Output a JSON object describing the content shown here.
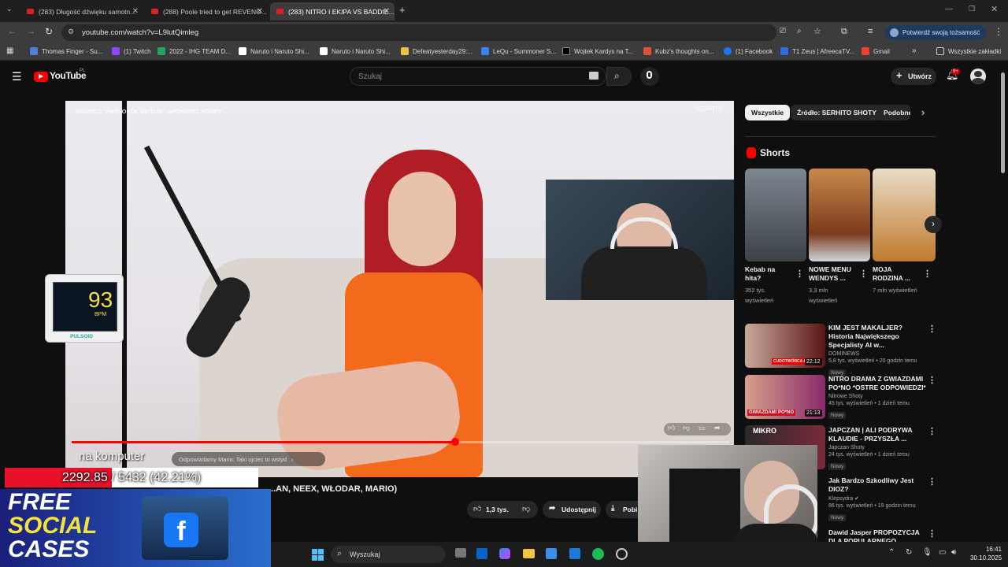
{
  "tabs": [
    {
      "label": "(283) Długość dźwięku samotn..."
    },
    {
      "label": "(288) Poole tried to get REVENG..."
    },
    {
      "label": "(283) NITRO I EKIPA VS BADDIE..."
    }
  ],
  "url": "youtube.com/watch?v=L9lutQimleg",
  "profile_chip": "Potwierdź swoją tożsamość",
  "bookmarks": [
    "Thomas Finger - Su...",
    "(1) Twitch",
    "2022 - IHG TEAM D...",
    "Naruto i Naruto Shi...",
    "Naruto i Naruto Shi...",
    "Defeatyesterday29:...",
    "LeQu - Summoner S...",
    "Wojtek Kardys na T...",
    "Kubz's thoughts on...",
    "(1) Facebook",
    "T1 Zeus | AfreecaTV...",
    "Gmail"
  ],
  "all_bookmarks": "Wszystkie zakładki",
  "yt": {
    "logo": "YouTube",
    "logo_region": "PL",
    "search_placeholder": "Szukaj",
    "create_label": "Utwórz",
    "notif_count": "9+"
  },
  "video": {
    "overlay_text": "BADDIEZ: PROTOKÓŁ BERLIN - SPOWIEDŹ HONEY",
    "watermark": "SERHITO",
    "chapter": "Odpowiadamy Mario: Taki ojciec to wstyd",
    "title_partial": "...AN, NEEX, WŁODAR, MARIO)",
    "likes": "1,3 tys.",
    "share": "Udostępnij",
    "download": "Pobi"
  },
  "chips": [
    "Wszystkie",
    "Źródło: SERHITO SHOTY",
    "Podobne"
  ],
  "shorts_heading": "Shorts",
  "shorts": [
    {
      "title": "Kebab na hita?",
      "views": "352 tys. wyświetleń"
    },
    {
      "title": "NOWE MENU WENDYS ...",
      "views": "3,3 mln wyświetleń"
    },
    {
      "title": "MOJA RODZINA ...",
      "views": "7 mln wyświetleń"
    }
  ],
  "recommended": [
    {
      "title": "KIM JEST MAKALJER? Historia Największego Specjalisty AI w...",
      "channel": "DOMINEWS",
      "meta": "5,8 tys. wyświetleń • 20 godzin temu",
      "badge": "Nowy",
      "duration": "22:12",
      "thumb_label": "CUDOTWÓRCA AI"
    },
    {
      "title": "NITRO DRAMA Z GWIAZDAMI PO*NO *OSTRE ODPOWIEDZI*",
      "channel": "Nitrowe Shoty",
      "meta": "45 tys. wyświetleń • 1 dzień temu",
      "badge": "Nowy",
      "duration": "21:13",
      "thumb_label": "GWIAZDAMI PO*NO"
    },
    {
      "title": "JAPCZAN | ALI PODRYWA KLAUDIE - PRZYSZŁA ...",
      "channel": "Japczan Shoty",
      "meta": "24 tys. wyświetleń • 1 dzień temu",
      "badge": "Nowy",
      "duration": "",
      "thumb_label": "MIKRO"
    },
    {
      "title": "Jak Bardzo Szkodliwy Jest DIOZ?",
      "channel": "Klepsydra",
      "meta": "86 tys. wyświetleń • 19 godzin temu",
      "badge": "Nowy",
      "duration": "",
      "thumb_label": ""
    },
    {
      "title": "Dawid Jasper PROPOZYCJA DLA POPULARNEGO...",
      "channel": "",
      "meta": "",
      "badge": "",
      "duration": "",
      "thumb_label": ""
    }
  ],
  "overlays": {
    "bpm_value": "93",
    "bpm_unit": "BPM",
    "bpm_brand": "PULSOID",
    "stream_caption": "na komputer",
    "progress_text": "2292.85 / 5432 (42.21%)",
    "progress_fraction": 0.4221,
    "promo_lines": [
      "FREE",
      "SOCIAL",
      "CASES"
    ]
  },
  "taskbar": {
    "search": "Wyszukaj",
    "time": "16:41",
    "date": "30.10.2025"
  },
  "colors": {
    "yt_red": "#ff0000",
    "progress_red": "#e8102a",
    "promo_yellow": "#f5e23c"
  }
}
